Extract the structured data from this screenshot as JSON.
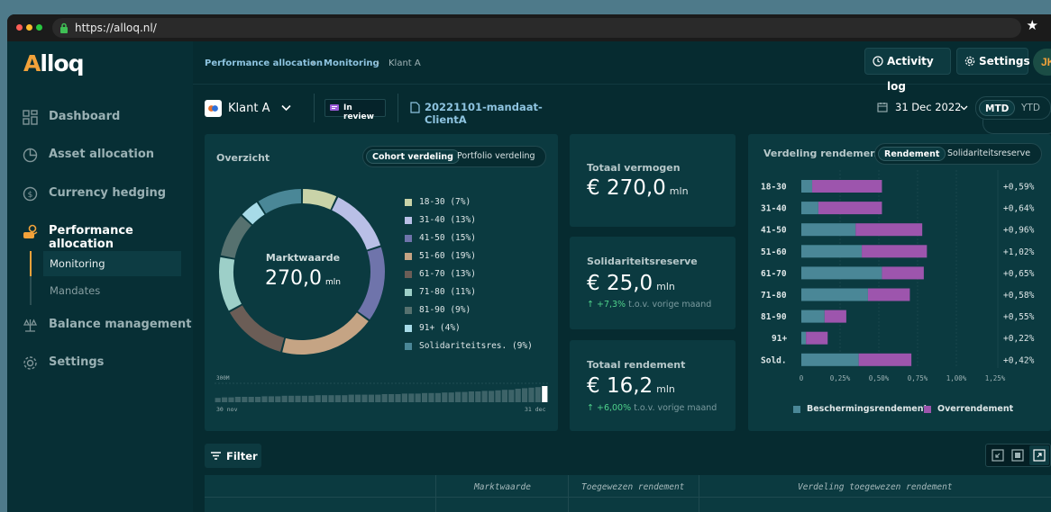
{
  "browser": {
    "url": "https://alloq.nl/"
  },
  "app": {
    "logo": "Alloq"
  },
  "sidebar": {
    "items": [
      {
        "label": "Dashboard",
        "icon": "dashboard-icon"
      },
      {
        "label": "Asset allocation",
        "icon": "pie-icon"
      },
      {
        "label": "Currency hedging",
        "icon": "currency-icon"
      },
      {
        "label": "Performance allocation",
        "icon": "performance-icon"
      },
      {
        "label": "Balance management",
        "icon": "scale-icon"
      },
      {
        "label": "Settings",
        "icon": "gear-icon"
      }
    ],
    "subitems": [
      {
        "label": "Monitoring"
      },
      {
        "label": "Mandates"
      }
    ]
  },
  "header": {
    "breadcrumb": [
      "Performance allocation",
      "Monitoring",
      "Klant A"
    ],
    "activity_label": "Activity log",
    "settings_label": "Settings",
    "avatar": "JK"
  },
  "toolbar": {
    "client": "Klant A",
    "status": "In review",
    "mandate": "20221101-mandaat-ClientA",
    "date": "31 Dec 2022",
    "period_options": [
      "MTD",
      "YTD"
    ],
    "period_selected": "MTD"
  },
  "overview": {
    "title": "Overzicht",
    "tabs": [
      "Cohort verdeling",
      "Portfolio verdeling"
    ],
    "center_label": "Marktwaarde",
    "center_value": "270,0",
    "center_unit": "mln",
    "spark_max": "300M",
    "spark_start": "30 nov",
    "spark_end": "31 dec"
  },
  "chart_data": [
    {
      "type": "pie",
      "title": "Overzicht",
      "labels": [
        "18-30 (7%)",
        "31-40 (13%)",
        "41-50 (15%)",
        "51-60 (19%)",
        "61-70 (13%)",
        "71-80 (11%)",
        "81-90 (9%)",
        "91+ (4%)",
        "Solidariteitsres. (9%)"
      ],
      "values": [
        7,
        13,
        15,
        19,
        13,
        11,
        9,
        4,
        9
      ],
      "colors": [
        "#c9d3a8",
        "#b9bfe6",
        "#6f74ab",
        "#c5a484",
        "#6b5d56",
        "#9dcfc8",
        "#56716f",
        "#a7dbe8",
        "#4a8797"
      ]
    },
    {
      "type": "bar",
      "title": "Verdeling rendement",
      "categories": [
        "18-30",
        "31-40",
        "41-50",
        "51-60",
        "61-70",
        "71-80",
        "81-90",
        "91+",
        "Sold."
      ],
      "series": [
        {
          "name": "Beschermingsrendement",
          "values": [
            0.07,
            0.11,
            0.35,
            0.39,
            0.52,
            0.43,
            0.15,
            0.03,
            0.37
          ]
        },
        {
          "name": "Overrendement",
          "values": [
            0.45,
            0.41,
            0.43,
            0.42,
            0.27,
            0.27,
            0.14,
            0.14,
            0.34
          ]
        }
      ],
      "totals": [
        "+0,59%",
        "+0,64%",
        "+0,96%",
        "+1,02%",
        "+0,65%",
        "+0,58%",
        "+0,55%",
        "+0,22%",
        "+0,42%"
      ],
      "xticks": [
        "0",
        "0,25%",
        "0,50%",
        "0,75%",
        "1,00%",
        "1,25%"
      ],
      "xlim": [
        0,
        1.25
      ],
      "colors": [
        "#4a8797",
        "#9d55ad"
      ],
      "legend": "bottom"
    }
  ],
  "sparkline_values": [
    8,
    9,
    9,
    10,
    10,
    10,
    10,
    11,
    11,
    11,
    12,
    12,
    12,
    12,
    12,
    13,
    13,
    13,
    13,
    13,
    14,
    14,
    14,
    14,
    14,
    15,
    15,
    15,
    16,
    16,
    16,
    17,
    17,
    17,
    18,
    18,
    19,
    19,
    20,
    20,
    21,
    21,
    22,
    23,
    23,
    25,
    26,
    27,
    28,
    30
  ],
  "stats": {
    "totaal_vermogen": {
      "label": "Totaal vermogen",
      "value": "€ 270,0",
      "unit": "mln"
    },
    "solidariteitsreserve": {
      "label": "Solidariteitsreserve",
      "value": "€ 25,0",
      "unit": "mln",
      "delta": "+7,3%",
      "delta_text": "t.o.v. vorige maand"
    },
    "totaal_rendement": {
      "label": "Totaal rendement",
      "value": "€ 16,2",
      "unit": "mln",
      "delta": "+6,00%",
      "delta_text": "t.o.v. vorige maand"
    }
  },
  "distribution": {
    "title": "Verdeling rendement",
    "tabs": [
      "Rendement",
      "Solidariteitsreserve"
    ],
    "legend": [
      "Beschermingsrendement",
      "Overrendement"
    ]
  },
  "filter": {
    "label": "Filter"
  },
  "table": {
    "headers": [
      "Marktwaarde",
      "Toegewezen rendement",
      "Verdeling toegewezen rendement"
    ]
  }
}
